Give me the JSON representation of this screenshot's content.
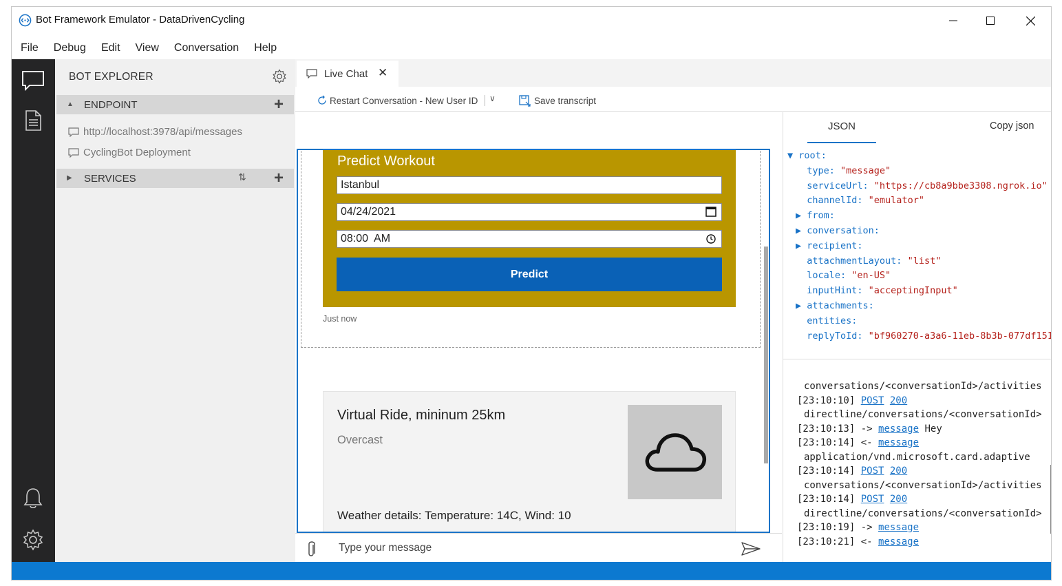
{
  "window": {
    "title": "Bot Framework Emulator - DataDrivenCycling",
    "minimize": "—",
    "maximize": "☐",
    "close": "✕"
  },
  "menu": [
    "File",
    "Debug",
    "Edit",
    "View",
    "Conversation",
    "Help"
  ],
  "explorer": {
    "title": "BOT EXPLORER",
    "endpoint_section": "ENDPOINT",
    "endpoints": [
      "http://localhost:3978/api/messages",
      "CyclingBot Deployment"
    ],
    "services_section": "SERVICES",
    "sort_glyph": "⇅",
    "add_glyph": "+"
  },
  "tab": {
    "label": "Live Chat",
    "close": "✕"
  },
  "toolbar": {
    "restart_label": "Restart Conversation - New User ID",
    "chevron": "∨",
    "save_label": "Save transcript"
  },
  "predict_card": {
    "title": "Predict Workout",
    "city": "Istanbul",
    "date": "04/24/2021",
    "time": "08:00  AM",
    "button": "Predict",
    "timestamp": "Just now"
  },
  "ride_card": {
    "title": "Virtual Ride, mininum 25km",
    "subtitle": "Overcast",
    "details": "Weather details: Temperature: 14C, Wind: 10"
  },
  "composer": {
    "placeholder": "Type your message"
  },
  "inspector": {
    "tab": "JSON",
    "copy": "Copy json",
    "json_rows": [
      {
        "prefix": "▼ ",
        "key": "root:",
        "value": ""
      },
      {
        "prefix": "  ",
        "key": "type: ",
        "value": "\"message\""
      },
      {
        "prefix": "  ",
        "key": "serviceUrl: ",
        "value": "\"https://cb8a9bbe3308.ngrok.io\""
      },
      {
        "prefix": "  ",
        "key": "channelId: ",
        "value": "\"emulator\""
      },
      {
        "prefix": "▶ ",
        "key": "from:",
        "value": ""
      },
      {
        "prefix": "▶ ",
        "key": "conversation:",
        "value": ""
      },
      {
        "prefix": "▶ ",
        "key": "recipient:",
        "value": ""
      },
      {
        "prefix": "  ",
        "key": "attachmentLayout: ",
        "value": "\"list\""
      },
      {
        "prefix": "  ",
        "key": "locale: ",
        "value": "\"en-US\""
      },
      {
        "prefix": "  ",
        "key": "inputHint: ",
        "value": "\"acceptingInput\""
      },
      {
        "prefix": "▶ ",
        "key": "attachments:",
        "value": ""
      },
      {
        "prefix": "  ",
        "key": "entities:",
        "value": ""
      },
      {
        "prefix": "  ",
        "key": "replyToId: ",
        "value": "\"bf960270-a3a6-11eb-8b3b-077df151"
      }
    ],
    "log": [
      {
        "indent": true,
        "time": "",
        "link1": "",
        "link2": "",
        "text": "conversations/<conversationId>/activities"
      },
      {
        "indent": false,
        "time": "[23:10:10] ",
        "link1": "POST",
        "link2": "200",
        "text": ""
      },
      {
        "indent": true,
        "time": "",
        "link1": "",
        "link2": "",
        "text": "directline/conversations/<conversationId>"
      },
      {
        "indent": false,
        "time": "[23:10:13] -> ",
        "link1": "message",
        "link2": "",
        "text": " Hey"
      },
      {
        "indent": false,
        "time": "[23:10:14] <- ",
        "link1": "message",
        "link2": "",
        "text": ""
      },
      {
        "indent": true,
        "time": "",
        "link1": "",
        "link2": "",
        "text": "application/vnd.microsoft.card.adaptive"
      },
      {
        "indent": false,
        "time": "[23:10:14] ",
        "link1": "POST",
        "link2": "200",
        "text": ""
      },
      {
        "indent": true,
        "time": "",
        "link1": "",
        "link2": "",
        "text": "conversations/<conversationId>/activities"
      },
      {
        "indent": false,
        "time": "[23:10:14] ",
        "link1": "POST",
        "link2": "200",
        "text": ""
      },
      {
        "indent": true,
        "time": "",
        "link1": "",
        "link2": "",
        "text": "directline/conversations/<conversationId>"
      },
      {
        "indent": false,
        "time": "[23:10:19] -> ",
        "link1": "message",
        "link2": "",
        "text": ""
      },
      {
        "indent": false,
        "time": "[23:10:21] <- ",
        "link1": "message",
        "link2": "",
        "text": ""
      }
    ]
  },
  "colors": {
    "accent": "#1a73c7",
    "card_gold": "#b99600",
    "predict_button": "#0a61b6",
    "status_bar": "#0c79d0",
    "rail": "#252526",
    "json_value": "#b5221c"
  },
  "icons": {
    "app": "bot-emulator-icon",
    "rail": [
      "chat-icon",
      "document-icon",
      "bell-icon",
      "gear-icon"
    ],
    "weather": "cloud-icon"
  }
}
